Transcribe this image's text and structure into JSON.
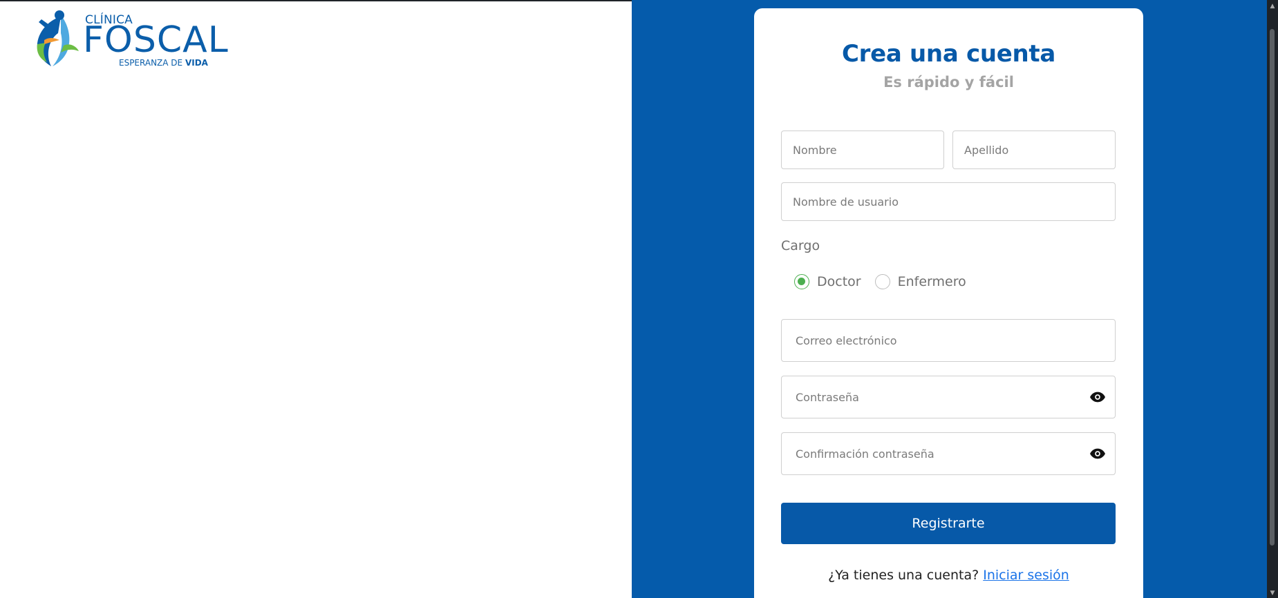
{
  "logo": {
    "line1": "CLÍNICA",
    "line2": "FOSCAL",
    "tagline_start": "ESPERANZA DE ",
    "tagline_bold": "VIDA"
  },
  "form": {
    "title": "Crea una cuenta",
    "subtitle": "Es rápido y fácil",
    "nombre_placeholder": "Nombre",
    "apellido_placeholder": "Apellido",
    "usuario_placeholder": "Nombre de usuario",
    "cargo_label": "Cargo",
    "roles": [
      {
        "label": "Doctor",
        "selected": true
      },
      {
        "label": "Enfermero",
        "selected": false
      }
    ],
    "correo_placeholder": "Correo electrónico",
    "password_placeholder": "Contraseña",
    "confirm_placeholder": "Confirmación contraseña",
    "submit_label": "Registrarte",
    "login_prompt": "¿Ya tienes una cuenta? ",
    "login_link": "Iniciar sesión"
  },
  "colors": {
    "brand_blue": "#055bab",
    "button_blue": "#0759a8",
    "radio_green": "#4caf50",
    "link_blue": "#1a73e8"
  },
  "icons": [
    "eye-icon",
    "chevron-up-icon",
    "chevron-down-icon"
  ]
}
